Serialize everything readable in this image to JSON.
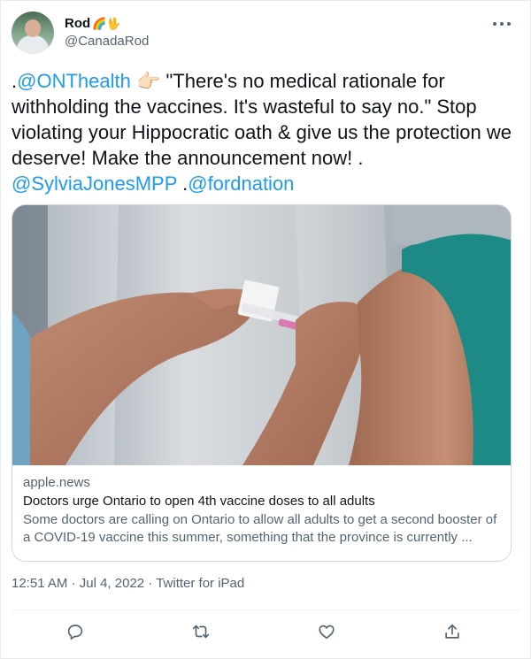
{
  "author": {
    "display_name": "Rod",
    "emoji": "🌈🖖",
    "handle": "@CanadaRod"
  },
  "tweet": {
    "pre1": ".",
    "mention1": "@ONThealth",
    "emoji": "👉🏻",
    "text1": " \"There's no medical rationale for withholding the vaccines. It's wasteful to say no.\" Stop violating your Hippocratic oath & give us the protection we deserve! Make the announcement now! . ",
    "mention2": "@SylviaJonesMPP",
    "text2": " .",
    "mention3": "@fordnation"
  },
  "card": {
    "domain": "apple.news",
    "title": "Doctors urge Ontario to open 4th vaccine doses to all adults",
    "description": "Some doctors are calling on Ontario to allow all adults to get a second booster of a COVID-19 vaccine this summer, something that the province is currently ..."
  },
  "meta": {
    "time": "12:51 AM",
    "sep1": " · ",
    "date": "Jul 4, 2022",
    "sep2": " · ",
    "source": "Twitter for iPad"
  },
  "colors": {
    "accent": "#1d9bf0",
    "secondary_text": "#536471",
    "border": "#cfd9de"
  },
  "icons": {
    "reply": "reply-icon",
    "retweet": "retweet-icon",
    "like": "like-icon",
    "share": "share-icon",
    "more": "more-icon"
  }
}
